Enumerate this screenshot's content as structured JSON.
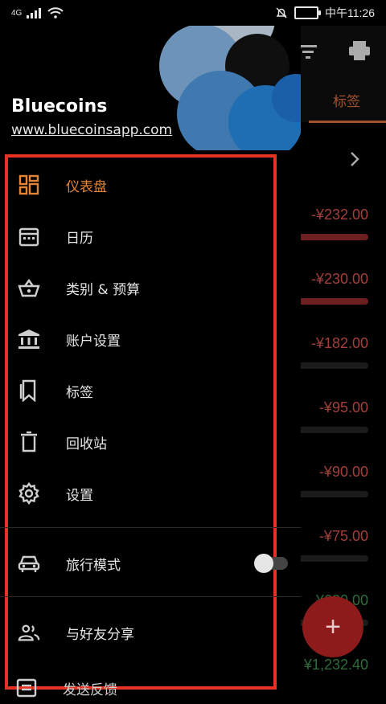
{
  "status_bar": {
    "network": "4G",
    "time": "中午11:26"
  },
  "drawer": {
    "app_name": "Bluecoins",
    "website": "www.bluecoinsapp.com",
    "menu": [
      {
        "label": "仪表盘",
        "icon": "dashboard-icon",
        "active": true
      },
      {
        "label": "日历",
        "icon": "calendar-icon"
      },
      {
        "label": "类别 & 预算",
        "icon": "basket-icon"
      },
      {
        "label": "账户设置",
        "icon": "bank-icon"
      },
      {
        "label": "标签",
        "icon": "bookmark-icon"
      },
      {
        "label": "回收站",
        "icon": "trash-icon"
      },
      {
        "label": "设置",
        "icon": "gear-icon"
      },
      {
        "label": "旅行模式",
        "icon": "car-icon"
      },
      {
        "label": "与好友分享",
        "icon": "people-icon"
      },
      {
        "label": "发送反馈",
        "icon": "feedback-icon"
      }
    ]
  },
  "background": {
    "tab_label": "标签",
    "amounts": [
      "-¥232.00",
      "-¥230.00",
      "-¥182.00",
      "-¥95.00",
      "-¥90.00",
      "-¥75.00",
      "¥680.00",
      "¥1,232.40"
    ],
    "fab_label": "+"
  },
  "colors": {
    "accent": "#e48535",
    "highlight_box": "#e53222",
    "negative": "#a23f3b",
    "positive": "#2f6b3a"
  }
}
